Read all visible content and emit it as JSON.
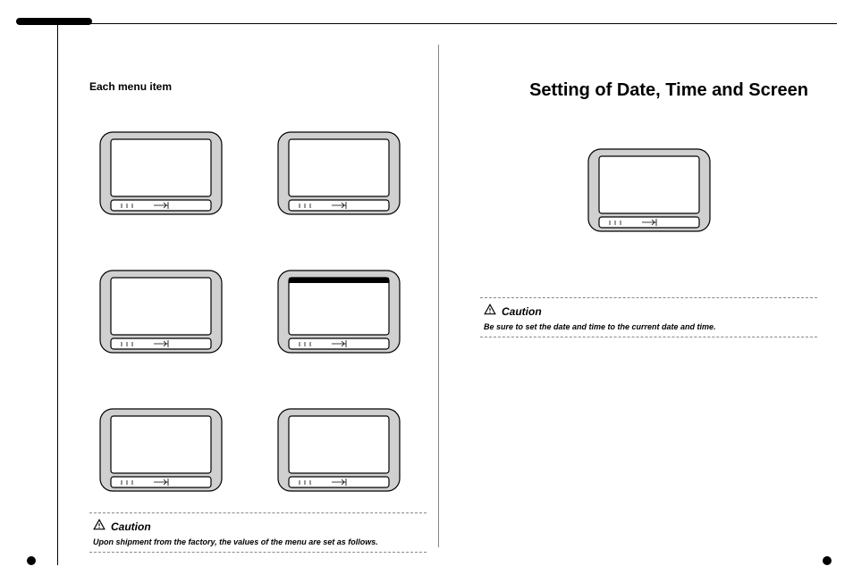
{
  "left": {
    "heading": "Each menu item",
    "caution_label": "Caution",
    "caution_text": "Upon shipment from the factory, the values of the menu are set as follows."
  },
  "right": {
    "title": "Setting of Date, Time and Screen",
    "caution_label": "Caution",
    "caution_text": "Be sure to set the date and time to the current date and time."
  }
}
